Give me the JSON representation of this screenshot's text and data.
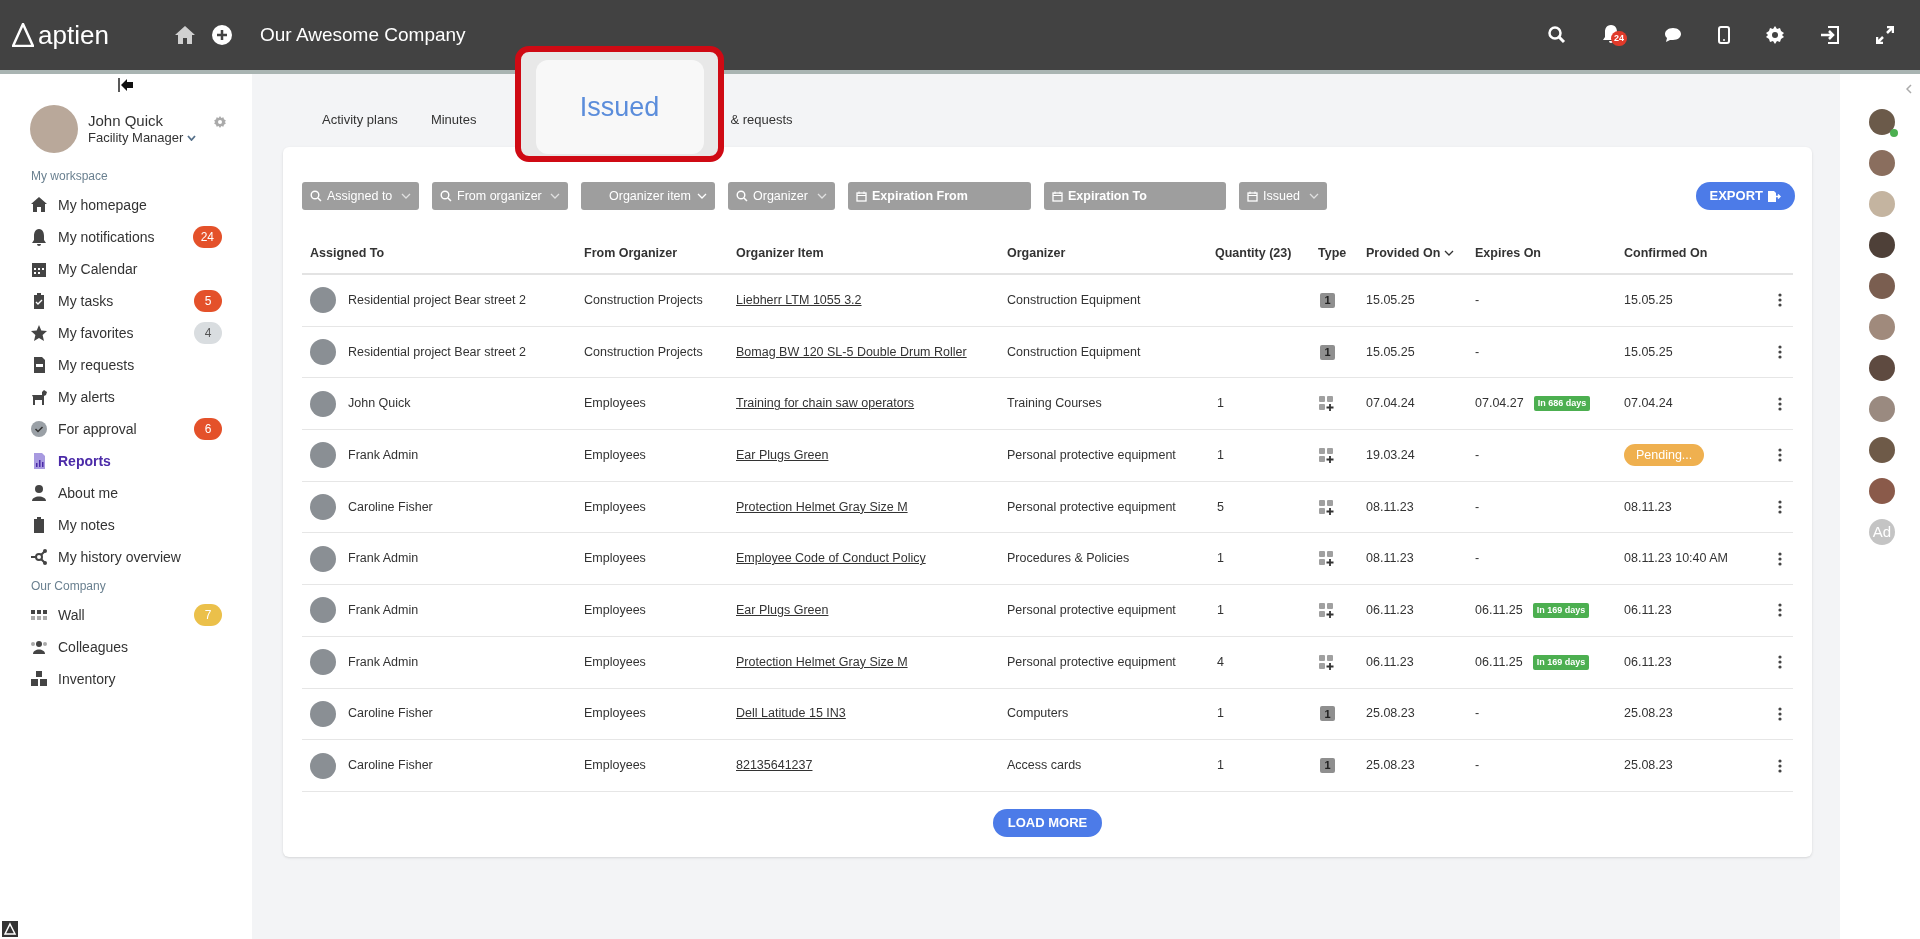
{
  "topbar": {
    "logo": "aptien",
    "title": "Our Awesome Company",
    "notifications_badge": "24"
  },
  "sidebar": {
    "user": {
      "name": "John Quick",
      "role": "Facility Manager"
    },
    "sections": [
      {
        "title": "My workspace",
        "items": [
          {
            "label": "My homepage",
            "selected": false
          },
          {
            "label": "My notifications",
            "selected": false,
            "badge": "24",
            "color": "#e4512a"
          },
          {
            "label": "My Calendar",
            "selected": false
          },
          {
            "label": "My tasks",
            "selected": false,
            "badge": "5",
            "color": "#e4512a"
          },
          {
            "label": "My favorites",
            "selected": false,
            "badge": "4",
            "color": "#d9dde0"
          },
          {
            "label": "My requests",
            "selected": false
          },
          {
            "label": "My alerts",
            "selected": false
          },
          {
            "label": "For approval",
            "selected": false,
            "badge": "6",
            "color": "#e4512a"
          },
          {
            "label": "Reports",
            "selected": true
          },
          {
            "label": "About me",
            "selected": false
          },
          {
            "label": "My notes",
            "selected": false
          },
          {
            "label": "My history overview",
            "selected": false
          }
        ]
      },
      {
        "title": "Our Company",
        "items": [
          {
            "label": "Wall",
            "selected": false,
            "badge": "7",
            "color": "#ebc04a"
          },
          {
            "label": "Colleagues",
            "selected": false
          },
          {
            "label": "Inventory",
            "selected": false
          }
        ]
      }
    ]
  },
  "tabs": [
    {
      "label": "Activity plans",
      "selected": false
    },
    {
      "label": "Minutes",
      "selected": false
    },
    {
      "label": "Issued",
      "selected": true
    },
    {
      "label": "& requests",
      "selected": false
    }
  ],
  "filters": [
    {
      "kind": "search",
      "label": "Assigned to"
    },
    {
      "kind": "search",
      "label": "From organizer"
    },
    {
      "kind": "select",
      "label": "Organizer item"
    },
    {
      "kind": "search",
      "label": "Organizer"
    },
    {
      "kind": "date",
      "label": "Expiration From"
    },
    {
      "kind": "date",
      "label": "Expiration To"
    },
    {
      "kind": "date-select",
      "label": "Issued"
    }
  ],
  "export_button": "EXPORT",
  "table": {
    "columns": [
      "Assigned To",
      "From Organizer",
      "Organizer Item",
      "Organizer",
      "Quantity (23)",
      "Type",
      "Provided On",
      "Expires On",
      "Confirmed On"
    ],
    "rows": [
      {
        "assigned_to": "Residential project Bear street 2",
        "from_organizer": "Construction Projects",
        "item": "Liebherr LTM 1055 3.2",
        "organizer": "Construction Equipment",
        "quantity": "",
        "type": {
          "kind": "single",
          "label": "1"
        },
        "provided_on": "15.05.25",
        "expires_on": "-",
        "confirmed_on": {
          "kind": "date",
          "text": "15.05.25"
        }
      },
      {
        "assigned_to": "Residential project Bear street 2",
        "from_organizer": "Construction Projects",
        "item": "Bomag BW 120 SL-5 Double Drum Roller",
        "organizer": "Construction Equipment",
        "quantity": "",
        "type": {
          "kind": "single",
          "label": "1"
        },
        "provided_on": "15.05.25",
        "expires_on": "-",
        "confirmed_on": {
          "kind": "date",
          "text": "15.05.25"
        }
      },
      {
        "assigned_to": "John Quick",
        "from_organizer": "Employees",
        "item": "Training for chain saw operators",
        "organizer": "Training Courses",
        "quantity": "1",
        "type": {
          "kind": "set"
        },
        "provided_on": "07.04.24",
        "expires_on": "07.04.27",
        "expires_badge": "In 686 days",
        "confirmed_on": {
          "kind": "date",
          "text": "07.04.24"
        }
      },
      {
        "assigned_to": "Frank Admin",
        "from_organizer": "Employees",
        "item": "Ear Plugs Green",
        "organizer": "Personal protective equipment",
        "quantity": "1",
        "type": {
          "kind": "set"
        },
        "provided_on": "19.03.24",
        "expires_on": "-",
        "confirmed_on": {
          "kind": "pending",
          "text": "Pending..."
        }
      },
      {
        "assigned_to": "Caroline Fisher",
        "from_organizer": "Employees",
        "item": "Protection Helmet Gray Size M",
        "organizer": "Personal protective equipment",
        "quantity": "5",
        "type": {
          "kind": "set"
        },
        "provided_on": "08.11.23",
        "expires_on": "-",
        "confirmed_on": {
          "kind": "date",
          "text": "08.11.23"
        }
      },
      {
        "assigned_to": "Frank Admin",
        "from_organizer": "Employees",
        "item": "Employee Code of Conduct Policy",
        "organizer": "Procedures & Policies",
        "quantity": "1",
        "type": {
          "kind": "set"
        },
        "provided_on": "08.11.23",
        "expires_on": "-",
        "confirmed_on": {
          "kind": "date",
          "text": "08.11.23 10:40 AM"
        }
      },
      {
        "assigned_to": "Frank Admin",
        "from_organizer": "Employees",
        "item": "Ear Plugs Green",
        "organizer": "Personal protective equipment",
        "quantity": "1",
        "type": {
          "kind": "set"
        },
        "provided_on": "06.11.23",
        "expires_on": "06.11.25",
        "expires_badge": "In 169 days",
        "confirmed_on": {
          "kind": "date",
          "text": "06.11.23"
        }
      },
      {
        "assigned_to": "Frank Admin",
        "from_organizer": "Employees",
        "item": "Protection Helmet Gray Size M",
        "organizer": "Personal protective equipment",
        "quantity": "4",
        "type": {
          "kind": "set"
        },
        "provided_on": "06.11.23",
        "expires_on": "06.11.25",
        "expires_badge": "In 169 days",
        "confirmed_on": {
          "kind": "date",
          "text": "06.11.23"
        }
      },
      {
        "assigned_to": "Caroline Fisher",
        "from_organizer": "Employees",
        "item": "Dell Latitude 15 IN3",
        "organizer": "Computers",
        "quantity": "1",
        "type": {
          "kind": "single",
          "label": "1"
        },
        "provided_on": "25.08.23",
        "expires_on": "-",
        "confirmed_on": {
          "kind": "date",
          "text": "25.08.23"
        }
      },
      {
        "assigned_to": "Caroline Fisher",
        "from_organizer": "Employees",
        "item": "82135641237",
        "organizer": "Access cards",
        "quantity": "1",
        "type": {
          "kind": "single",
          "label": "1"
        },
        "provided_on": "25.08.23",
        "expires_on": "-",
        "confirmed_on": {
          "kind": "date",
          "text": "25.08.23"
        }
      }
    ]
  },
  "load_more": "LOAD MORE",
  "colleagues": [
    {
      "online": true
    },
    {
      "online": false
    },
    {
      "online": false
    },
    {
      "online": false
    },
    {
      "online": false
    },
    {
      "online": false
    },
    {
      "online": false
    },
    {
      "online": false
    },
    {
      "online": false
    },
    {
      "online": false
    },
    {
      "online": false,
      "initials": "Ad"
    }
  ]
}
